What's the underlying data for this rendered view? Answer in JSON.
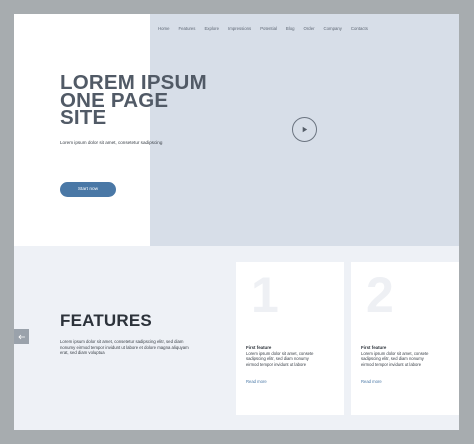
{
  "nav": {
    "items": [
      "Home",
      "Features",
      "Explore",
      "Impressions",
      "Potential",
      "Blog",
      "Order",
      "Company",
      "Contacts"
    ]
  },
  "hero": {
    "title_line1": "LOREM IPSUM",
    "title_line2": "ONE PAGE",
    "title_line3": "SITE",
    "subtitle": "Lorem ipsum dolor sit amet, consetetur sadipscing",
    "cta_label": "Start now"
  },
  "features": {
    "title": "FEATURES",
    "text": "Lorem ipsum dolor sit amet, consetetur sadipscing elitr, sed diam nonumy eirmod tempor invidunt ut labore et dolore magna aliquyam erat, sed diam voluptua",
    "cards": [
      {
        "number": "1",
        "title": "First feature",
        "text": "Lorem ipsum dolor sit amet, consete sadipscing elitr, sed diam nonumy eirmod tempor invidunt ut labore",
        "link": "Read more"
      },
      {
        "number": "2",
        "title": "First feature",
        "text": "Lorem ipsum dolor sit amet, consete sadipscing elitr, sed diam nonumy eirmod tempor invidunt ut labore",
        "link": "Read more"
      }
    ]
  },
  "icons": {
    "play": "play-icon",
    "arrow_left": "arrow-left-icon",
    "arrow_right": "arrow-right-icon"
  },
  "colors": {
    "background": "#a7acaf",
    "hero_panel": "#d7dee8",
    "accent": "#4a78a6",
    "heading": "#515a66"
  }
}
